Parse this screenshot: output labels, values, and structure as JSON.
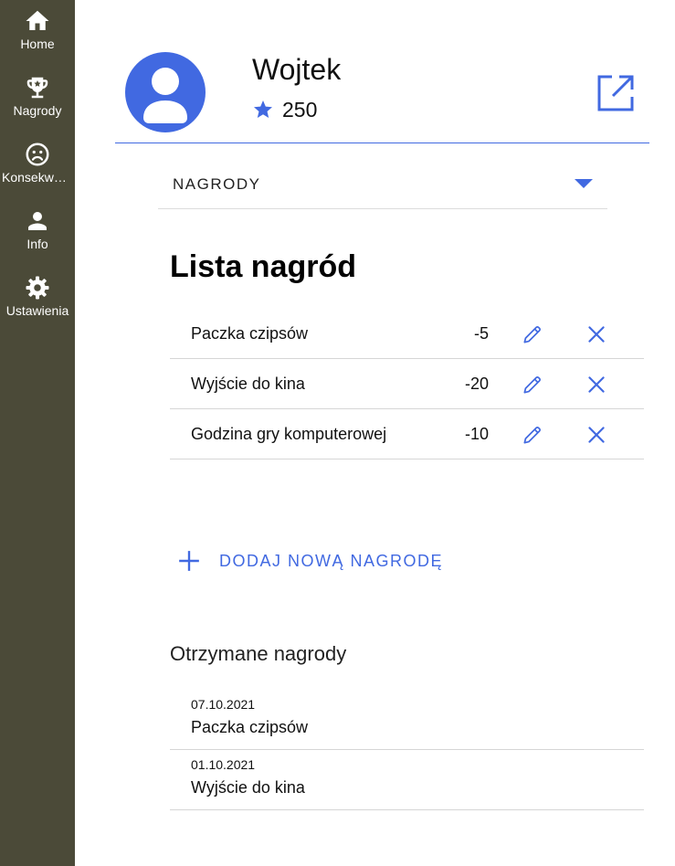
{
  "colors": {
    "sidebar_bg": "#4b4a38",
    "accent": "#4169e1",
    "divider": "#d6d6d6"
  },
  "sidebar": {
    "items": [
      {
        "label": "Home",
        "icon": "home-icon"
      },
      {
        "label": "Nagrody",
        "icon": "trophy-icon"
      },
      {
        "label": "Konsekwencje",
        "icon": "sad-face-icon"
      },
      {
        "label": "Info",
        "icon": "person-icon"
      },
      {
        "label": "Ustawienia",
        "icon": "gear-icon"
      }
    ]
  },
  "header": {
    "user_name": "Wojtek",
    "points": "250",
    "avatar_icon": "account-icon",
    "points_icon": "star-icon",
    "open_icon": "open-in-new-icon"
  },
  "dropdown": {
    "selected": "NAGRODY"
  },
  "rewards": {
    "title": "Lista nagród",
    "items": [
      {
        "name": "Paczka czipsów",
        "cost": "-5"
      },
      {
        "name": "Wyjście do kina",
        "cost": "-20"
      },
      {
        "name": "Godzina gry komputerowej",
        "cost": "-10"
      }
    ],
    "add_label": "DODAJ NOWĄ NAGRODĘ"
  },
  "received": {
    "title": "Otrzymane nagrody",
    "items": [
      {
        "date": "07.10.2021",
        "name": "Paczka czipsów"
      },
      {
        "date": "01.10.2021",
        "name": "Wyjście do kina"
      }
    ]
  }
}
